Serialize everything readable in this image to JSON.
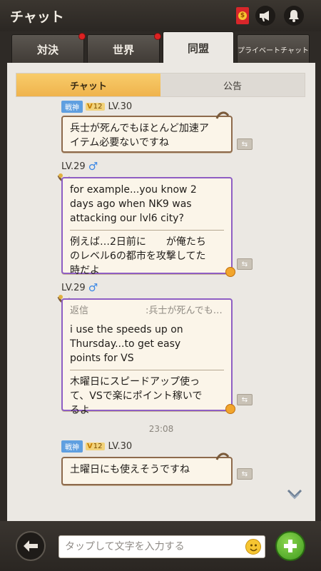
{
  "header": {
    "title": "チャット"
  },
  "tabs": [
    {
      "label": "対決",
      "has_dot": true
    },
    {
      "label": "世界",
      "has_dot": true
    },
    {
      "label": "同盟",
      "active": true
    },
    {
      "label": "プライベートチャット"
    }
  ],
  "subtabs": [
    {
      "label": "チャット",
      "active": true
    },
    {
      "label": "公告"
    }
  ],
  "messages": [
    {
      "rank": "戦神",
      "vip": "12",
      "level": "LV.30",
      "lines": [
        "兵士が死んでもほとんど加速ア",
        "イテム必要ないですね"
      ]
    },
    {
      "level": "LV.29",
      "gender": "♂",
      "en_lines": [
        "for example...you know 2",
        "days ago when NK9 was",
        "attacking our lvl6 city?"
      ],
      "ja_lines": [
        "例えば…2日前に　　が俺たち",
        "のレベル6の都市を攻撃してた",
        "時だよ"
      ]
    },
    {
      "level": "LV.29",
      "gender": "♂",
      "reply_prefix": "返信",
      "reply_text": ":兵士が死んでも…",
      "en_lines": [
        "i use the speeds up on",
        "Thursday...to get easy",
        "points for VS"
      ],
      "ja_lines": [
        "木曜日にスピードアップ使っ",
        "て、VSで楽にポイント稼いで",
        "るよ"
      ]
    },
    {
      "rank": "戦神",
      "vip": "12",
      "level": "LV.30",
      "lines": [
        "土曜日にも使えそうですね"
      ]
    }
  ],
  "timestamp": "23:08",
  "input": {
    "placeholder": "タップして文字を入力する"
  },
  "icons": {
    "redpack": "red-envelope-icon",
    "speaker": "megaphone-icon",
    "bell": "bell-icon",
    "back": "back-arrow-icon",
    "emoji": "smiley-icon",
    "add": "plus-icon",
    "translate": "translate-icon",
    "scroll": "scroll-down-icon"
  }
}
